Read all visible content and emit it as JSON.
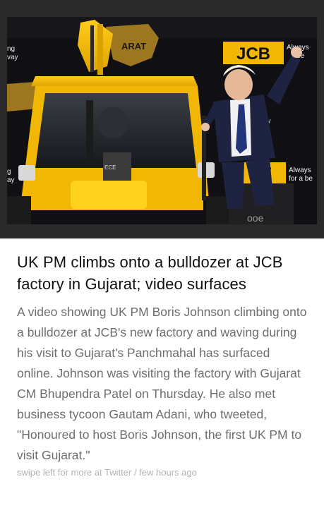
{
  "article": {
    "headline": "UK PM climbs onto a bulldozer at JCB factory in Gujarat; video surfaces",
    "body": "A video showing UK PM Boris Johnson climbing onto a bulldozer at JCB's new factory and waving during his visit to Gujarat's Panchmahal has surfaced online. Johnson was visiting the factory with Gujarat CM Bhupendra Patel on Thursday. He also met business tycoon Gautam Adani, who tweeted, \"Honoured to host Boris Johnson, the first UK PM to visit Gujarat.\""
  },
  "footer": {
    "text": "swipe left for more at Twitter / few hours ago"
  },
  "image": {
    "backdrop_logo": "JCB",
    "backdrop_tagline_top": "Always",
    "backdrop_tagline_top2": "be",
    "backdrop_logo_lower": "CE",
    "backdrop_tagline_lower1": "Always",
    "backdrop_tagline_lower2": "for a be",
    "left_text_1": "ng",
    "left_text_2": "vay",
    "left_text_3": "g",
    "left_text_4": "ay",
    "map_text": "ARAT",
    "right_mid_1": "g",
    "right_mid_2": "ay",
    "bucket_text": "ECE",
    "cab_number": "ooe"
  },
  "colors": {
    "jcb_yellow": "#f2b705",
    "backdrop": "#101014",
    "suit": "#1d2340"
  }
}
